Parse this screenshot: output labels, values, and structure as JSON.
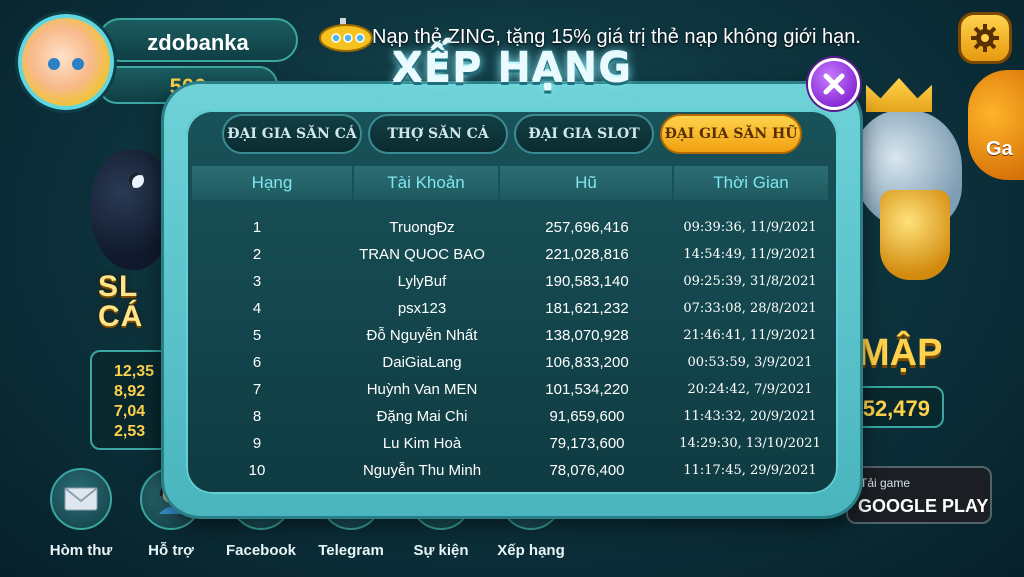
{
  "background": {
    "left_title_line1": "SL",
    "left_title_line2": "CÁ",
    "left_values": [
      "12,35",
      "8,92",
      "7,04",
      "2,53"
    ],
    "right_fish_label": "Ga",
    "right_title": "MẬP",
    "right_value": "52,479"
  },
  "user": {
    "name": "zdobanka",
    "coins": "500"
  },
  "marquee": "Nạp thẻ ZING, tặng 15% giá trị thẻ nạp không giới hạn.",
  "modal": {
    "title": "XẾP HẠNG",
    "tabs": [
      {
        "label": "ĐẠI GIA SĂN CÁ",
        "active": false
      },
      {
        "label": "THỢ SĂN CÁ",
        "active": false
      },
      {
        "label": "ĐẠI GIA SLOT",
        "active": false
      },
      {
        "label": "ĐẠI GIA SĂN HŨ",
        "active": true
      }
    ],
    "columns": [
      "Hạng",
      "Tài Khoản",
      "Hũ",
      "Thời Gian"
    ],
    "rows": [
      {
        "rank": "1",
        "account": "TruongĐz",
        "jackpot": "257,696,416",
        "time": "09:39:36, 11/9/2021"
      },
      {
        "rank": "2",
        "account": "TRAN QUOC BAO",
        "jackpot": "221,028,816",
        "time": "14:54:49, 11/9/2021"
      },
      {
        "rank": "3",
        "account": "LylyBuf",
        "jackpot": "190,583,140",
        "time": "09:25:39, 31/8/2021"
      },
      {
        "rank": "4",
        "account": "psx123",
        "jackpot": "181,621,232",
        "time": "07:33:08, 28/8/2021"
      },
      {
        "rank": "5",
        "account": "Đỗ Nguyễn Nhất",
        "jackpot": "138,070,928",
        "time": "21:46:41, 11/9/2021"
      },
      {
        "rank": "6",
        "account": "DaiGiaLang",
        "jackpot": "106,833,200",
        "time": "00:53:59, 3/9/2021"
      },
      {
        "rank": "7",
        "account": "Huỳnh Van MEN",
        "jackpot": "101,534,220",
        "time": "20:24:42, 7/9/2021"
      },
      {
        "rank": "8",
        "account": "Đặng Mai Chi",
        "jackpot": "91,659,600",
        "time": "11:43:32, 20/9/2021"
      },
      {
        "rank": "9",
        "account": "Lu Kim Hoà",
        "jackpot": "79,173,600",
        "time": "14:29:30, 13/10/2021"
      },
      {
        "rank": "10",
        "account": "Nguyễn Thu Minh",
        "jackpot": "78,076,400",
        "time": "11:17:45, 29/9/2021"
      }
    ]
  },
  "nav": [
    {
      "label": "Hòm thư",
      "icon": "mail-icon"
    },
    {
      "label": "Hỗ trợ",
      "icon": "support-icon"
    },
    {
      "label": "Facebook",
      "icon": "facebook-icon"
    },
    {
      "label": "Telegram",
      "icon": "telegram-icon"
    },
    {
      "label": "Sự kiện",
      "icon": "event-icon"
    },
    {
      "label": "Xếp hạng",
      "icon": "ranking-icon"
    }
  ],
  "store": {
    "small": "Tải game",
    "big": "GOOGLE PLAY"
  },
  "colors": {
    "accent_gold": "#ffd24d",
    "header_cyan": "#7fe6ee",
    "frame_teal": "#4ab5be",
    "close_purple": "#8a2dd6"
  }
}
